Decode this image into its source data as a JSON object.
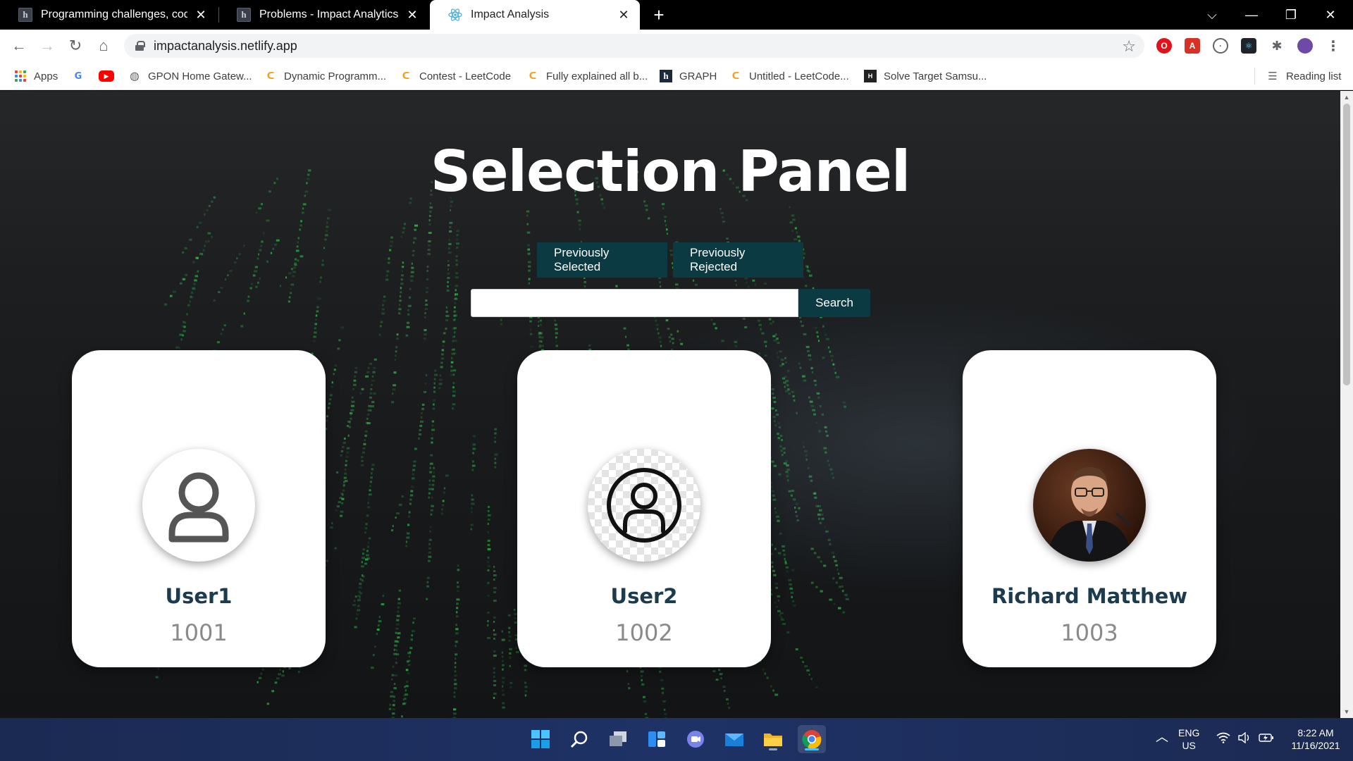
{
  "browser": {
    "tabs": [
      {
        "title": "Programming challenges, coding",
        "favicon": "hackerrank-h-icon",
        "active": false
      },
      {
        "title": "Problems - Impact Analytics Softw",
        "favicon": "hackerrank-h-icon",
        "active": false
      },
      {
        "title": "Impact Analysis",
        "favicon": "react-icon",
        "active": true
      }
    ],
    "new_tab_symbol": "+",
    "window_controls": {
      "tab_search": "⌵",
      "minimize": "—",
      "restore": "❐",
      "close": "✕"
    },
    "url": "impactanalysis.netlify.app",
    "bookmarks": [
      {
        "label": "Apps",
        "icon": "apps-grid-icon"
      },
      {
        "label": "",
        "icon": "google-g-icon"
      },
      {
        "label": "",
        "icon": "youtube-icon"
      },
      {
        "label": "GPON Home Gatew...",
        "icon": "globe-icon"
      },
      {
        "label": "Dynamic Programm...",
        "icon": "leetcode-icon"
      },
      {
        "label": "Contest - LeetCode",
        "icon": "leetcode-icon"
      },
      {
        "label": "Fully explained all b...",
        "icon": "leetcode-icon"
      },
      {
        "label": "GRAPH",
        "icon": "hackerrank-h-icon"
      },
      {
        "label": "Untitled - LeetCode...",
        "icon": "leetcode-icon"
      },
      {
        "label": "Solve Target Samsu...",
        "icon": "hackerearth-icon"
      }
    ],
    "reading_list": "Reading list"
  },
  "page": {
    "title": "Selection Panel",
    "buttons": {
      "previously_selected": "Previously Selected",
      "previously_rejected": "Previously Rejected"
    },
    "search": {
      "placeholder": "",
      "value": "",
      "button": "Search"
    },
    "cards": [
      {
        "name": "User1",
        "id": "1001",
        "avatar": "user-outline-icon"
      },
      {
        "name": "User2",
        "id": "1002",
        "avatar": "user-circle-outline-icon"
      },
      {
        "name": "Richard Matthew",
        "id": "1003",
        "avatar": "user-photo"
      }
    ]
  },
  "taskbar": {
    "apps": [
      "windows-start-icon",
      "search-icon",
      "task-view-icon",
      "widgets-icon",
      "teams-chat-icon",
      "mail-icon",
      "file-explorer-icon",
      "chrome-icon"
    ],
    "language": {
      "line1": "ENG",
      "line2": "US"
    },
    "time": "8:22 AM",
    "date": "11/16/2021"
  },
  "colors": {
    "button_bg": "#0b3a43",
    "card_name": "#1d3b4f",
    "card_id": "#8a8a8a",
    "taskbar": "#1f3266"
  }
}
